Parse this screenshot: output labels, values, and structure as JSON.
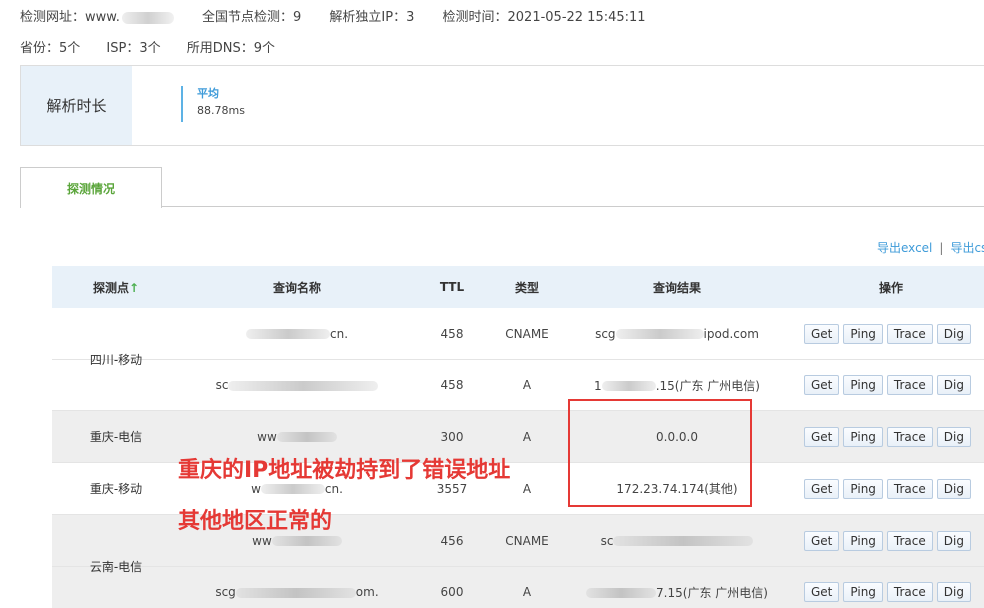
{
  "header": {
    "url_label": "检测网址：www.",
    "nodes_label": "全国节点检测：9",
    "ip_label": "解析独立IP：3",
    "time_label": "检测时间：2021-05-22 15:45:11",
    "province_label": "省份：5个",
    "isp_label": "ISP：3个",
    "dns_label": "所用DNS：9个"
  },
  "summary": {
    "title": "解析时长",
    "avg_label": "平均",
    "avg_value": "88.78ms"
  },
  "tab": {
    "label": "探测情况"
  },
  "export": {
    "excel": "导出excel",
    "sep": "|",
    "csv": "导出cs"
  },
  "table": {
    "headers": {
      "probe": "探测点",
      "probe_arrow": "↑",
      "name": "查询名称",
      "ttl": "TTL",
      "type": "类型",
      "result": "查询结果",
      "ops": "操作"
    },
    "buttons": {
      "get": "Get",
      "ping": "Ping",
      "trace": "Trace",
      "dig": "Dig"
    },
    "groups": [
      {
        "location": "四川-移动",
        "rows": [
          {
            "name_suffix": "cn.",
            "ttl": "458",
            "type": "CNAME",
            "result_prefix": "scg",
            "result_suffix": "ipod.com"
          },
          {
            "name_prefix": "sc",
            "ttl": "458",
            "type": "A",
            "result_prefix": "1",
            "result_suffix": ".15(广东 广州电信)"
          }
        ]
      },
      {
        "location": "重庆-电信",
        "rows": [
          {
            "name_prefix": "ww",
            "ttl": "300",
            "type": "A",
            "result": "0.0.0.0"
          }
        ]
      },
      {
        "location": "重庆-移动",
        "rows": [
          {
            "name_prefix": "w",
            "name_suffix": "cn.",
            "ttl": "3557",
            "type": "A",
            "result": "172.23.74.174(其他)"
          }
        ]
      },
      {
        "location": "云南-电信",
        "rows": [
          {
            "name_prefix": "ww",
            "ttl": "456",
            "type": "CNAME",
            "result_prefix": "sc"
          },
          {
            "name_prefix": "scg",
            "name_suffix": "om.",
            "ttl": "600",
            "type": "A",
            "result_suffix": "7.15(广东 广州电信)"
          }
        ]
      }
    ]
  },
  "annotations": {
    "line1": "重庆的IP地址被劫持到了错误地址",
    "line2": "其他地区正常的"
  },
  "colors": {
    "accent_blue": "#3e9bd9",
    "tab_green": "#5aa53a",
    "annotation_red": "#e53935",
    "header_bg": "#e8f1f9"
  }
}
